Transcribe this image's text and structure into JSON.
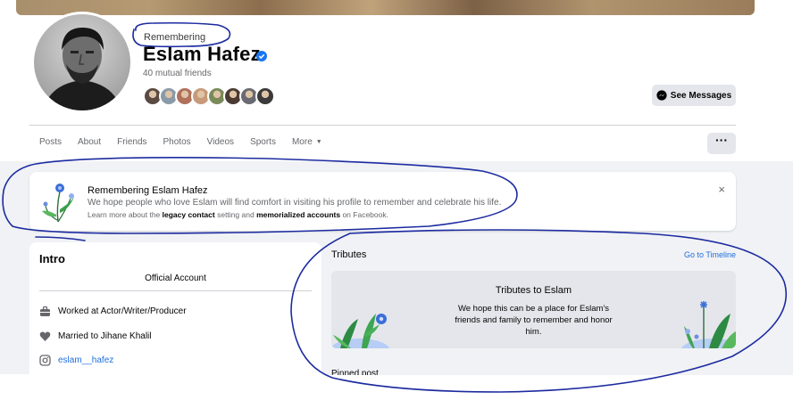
{
  "profile": {
    "status_label": "Remembering",
    "name": "Eslam Hafez",
    "verified_icon": "verified-badge-icon",
    "mutual_friends": "40 mutual friends",
    "friend_avatar_colors": [
      "#5a4a42",
      "#8a9aa8",
      "#b0705a",
      "#c79a7a",
      "#7a8a5a",
      "#4a3a32",
      "#6a6a72",
      "#3a3a3a"
    ],
    "see_messages_label": "See Messages"
  },
  "tabs": {
    "items": [
      {
        "label": "Posts"
      },
      {
        "label": "About"
      },
      {
        "label": "Friends"
      },
      {
        "label": "Photos"
      },
      {
        "label": "Videos"
      },
      {
        "label": "Sports"
      }
    ],
    "more_label": "More",
    "more_caret": "▼",
    "overflow_label": "···"
  },
  "banner": {
    "title": "Remembering Eslam Hafez",
    "line1": "We hope people who love Eslam will find comfort in visiting his profile to remember and celebrate his life.",
    "line2_prefix": "Learn more about the",
    "legacy_contact": "legacy contact",
    "line2_mid": "setting and",
    "memorialized_accounts": "memorialized accounts",
    "line2_suffix": "on Facebook.",
    "close": "×"
  },
  "intro": {
    "title": "Intro",
    "official": "Official Account",
    "work": "Worked at Actor/Writer/Producer",
    "relationship": "Married to Jihane Khalil",
    "instagram": "eslam__hafez"
  },
  "tributes": {
    "heading": "Tributes",
    "go_to_timeline": "Go to Timeline",
    "box_title": "Tributes to Eslam",
    "box_text": "We hope this can be a place for Eslam's friends and family to remember and honor him.",
    "pinned": "Pinned post"
  },
  "colors": {
    "accent": "#216fdb",
    "annotation_ink": "#1c2ba0",
    "page_bg": "#f0f2f5"
  }
}
